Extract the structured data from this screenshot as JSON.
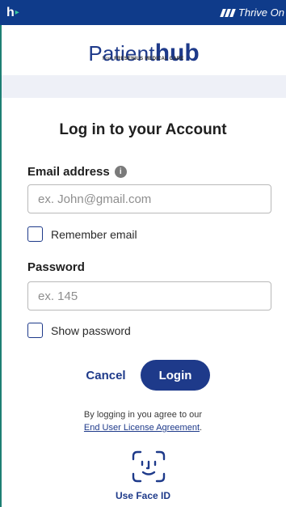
{
  "topbar": {
    "brand_letter": "h",
    "brand_arrow": "▸",
    "tagline": "Thrive On"
  },
  "logo": {
    "word_light": "Patient",
    "word_bold": "hub",
    "sub_prefix": "from ",
    "sub_company": "FRESENIUS MEDICAL CARE"
  },
  "form": {
    "title": "Log in to your Account",
    "email_label": "Email address",
    "email_placeholder": "ex. John@gmail.com",
    "email_value": "",
    "remember_label": "Remember email",
    "password_label": "Password",
    "password_placeholder": "ex. 145",
    "password_value": "",
    "show_password_label": "Show password"
  },
  "actions": {
    "cancel_label": "Cancel",
    "login_label": "Login"
  },
  "legal": {
    "prefix": "By logging in you agree to our",
    "link": "End User License Agreement",
    "suffix": "."
  },
  "face_id": {
    "label": "Use Face ID"
  },
  "colors": {
    "primary": "#1e3a8a",
    "topbar": "#0f3b8a",
    "accent_green": "#37c8a0"
  },
  "icons": [
    "info-icon",
    "face-id-icon"
  ]
}
